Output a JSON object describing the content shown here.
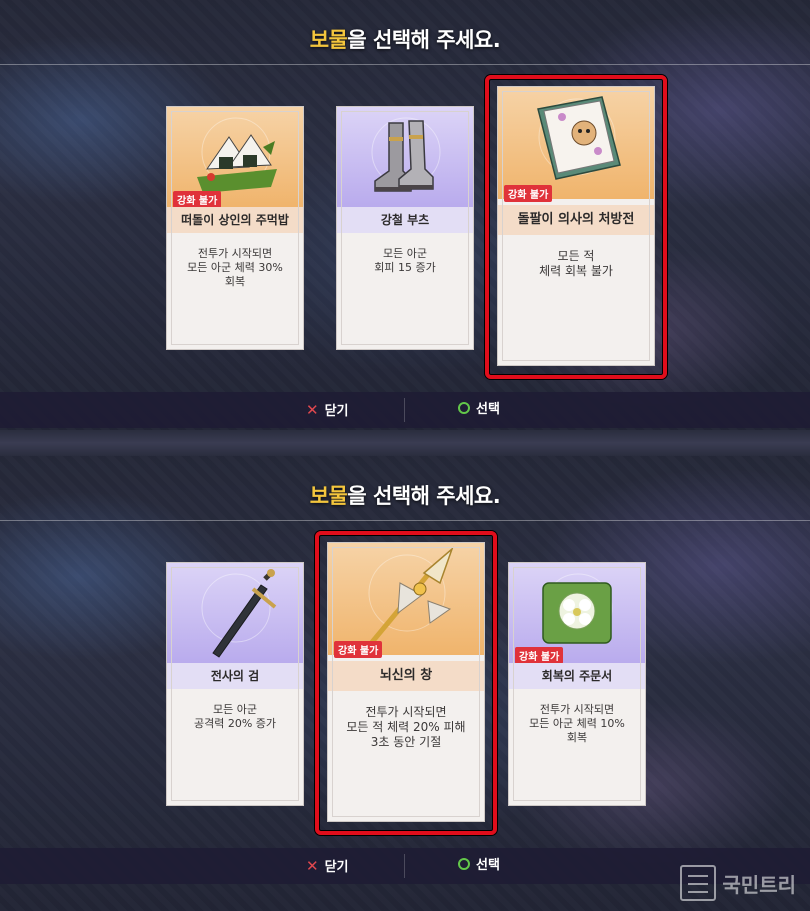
{
  "colors": {
    "accent": "#f4c63d",
    "badge": "#e0323a",
    "selection": "#e00d1b",
    "close": "#e0484f",
    "select": "#63c74a"
  },
  "panels": [
    {
      "title_accent": "보물",
      "title_rest": "을 선택해 주세요.",
      "cards": [
        {
          "theme": "orange",
          "icon": "rice-ball-icon",
          "badge": "강화 불가",
          "name": "떠돌이 상인의 주먹밥",
          "desc": "전투가 시작되면\n모든 아군 체력 30%\n회복",
          "selected": false
        },
        {
          "theme": "purple",
          "icon": "steel-boots-icon",
          "badge": "",
          "name": "강철 부츠",
          "desc": "모든 아군\n회피 15 증가",
          "selected": false
        },
        {
          "theme": "orange",
          "icon": "prescription-book-icon",
          "badge": "강화 불가",
          "name": "돌팔이 의사의 처방전",
          "desc": "모든 적\n체력 회복 불가",
          "selected": true
        }
      ],
      "buttons": {
        "close": "닫기",
        "select": "선택"
      }
    },
    {
      "title_accent": "보물",
      "title_rest": "을 선택해 주세요.",
      "cards": [
        {
          "theme": "purple",
          "icon": "sword-icon",
          "badge": "",
          "name": "전사의 검",
          "desc": "모든 아군\n공격력 20% 증가",
          "selected": false
        },
        {
          "theme": "orange",
          "icon": "thunder-spear-icon",
          "badge": "강화 불가",
          "name": "뇌신의 창",
          "desc": "전투가 시작되면\n모든 적 체력 20% 피해\n3초 동안 기절",
          "selected": true
        },
        {
          "theme": "purple",
          "icon": "healing-scroll-icon",
          "badge": "강화 불가",
          "name": "회복의 주문서",
          "desc": "전투가 시작되면\n모든 아군 체력 10%\n회복",
          "selected": false
        }
      ],
      "buttons": {
        "close": "닫기",
        "select": "선택"
      }
    }
  ],
  "watermark": "국민트리"
}
